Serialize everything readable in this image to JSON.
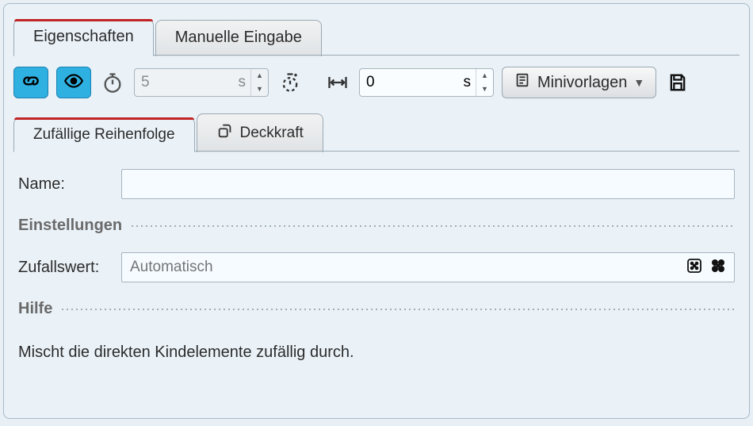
{
  "main_tabs": {
    "eigenschaften": "Eigenschaften",
    "manuelle": "Manuelle Eingabe"
  },
  "toolbar": {
    "duration_value": "5",
    "duration_unit": "s",
    "offset_value": "0",
    "offset_unit": "s",
    "minivorlagen_label": "Minivorlagen"
  },
  "sub_tabs": {
    "zufall": "Zufällige Reihenfolge",
    "deckkraft": "Deckkraft"
  },
  "form": {
    "name_label": "Name:",
    "name_value": "",
    "settings_header": "Einstellungen",
    "zufall_label": "Zufallswert:",
    "zufall_placeholder": "Automatisch",
    "help_header": "Hilfe",
    "help_text": "Mischt die direkten Kindelemente zufällig durch."
  }
}
